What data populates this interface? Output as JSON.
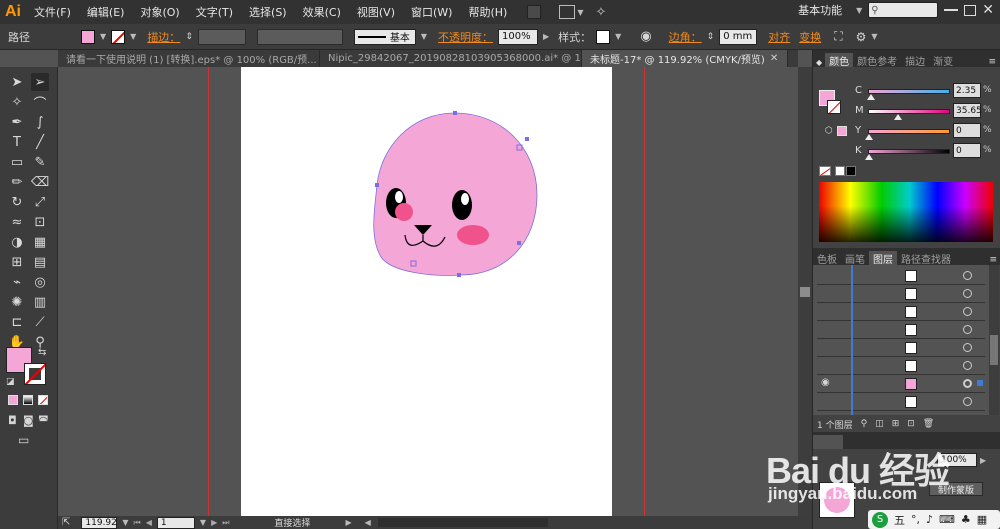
{
  "app": {
    "logo": "Ai",
    "workspace": "基本功能"
  },
  "menu": [
    "文件(F)",
    "编辑(E)",
    "对象(O)",
    "文字(T)",
    "选择(S)",
    "效果(C)",
    "视图(V)",
    "窗口(W)",
    "帮助(H)"
  ],
  "control": {
    "mode_label": "路径",
    "stroke_label": "描边：",
    "stroke_style": "基本",
    "opacity_label": "不透明度：",
    "opacity_value": "100%",
    "style_label": "样式：",
    "corner_label": "边角：",
    "corner_value": "0 mm",
    "align_label": "对齐",
    "transform_label": "变换"
  },
  "tabs": [
    {
      "label": "请看一下使用说明 (1) [转换].eps* @ 100% (RGB/预..."
    },
    {
      "label": "Nipic_29842067_20190828103905368000.ai* @ 11..."
    },
    {
      "label": "未标题-17* @ 119.92% (CMYK/预览)"
    }
  ],
  "color_panel": {
    "tabs": [
      "颜色",
      "颜色参考",
      "描边",
      "渐变"
    ],
    "channels": [
      {
        "name": "C",
        "value": "2.35",
        "level": 0.0235
      },
      {
        "name": "M",
        "value": "35.65",
        "level": 0.3565
      },
      {
        "name": "Y",
        "value": "0",
        "level": 0
      },
      {
        "name": "K",
        "value": "0",
        "level": 0
      }
    ],
    "unit": "%"
  },
  "layers_panel": {
    "tabs": [
      "色板",
      "画笔",
      "图层",
      "路径查找器"
    ],
    "footer_count": "1 个图层"
  },
  "transparency_panel": {
    "opacity_value": "100%",
    "make_mask": "制作蒙版"
  },
  "status": {
    "zoom": "119.92",
    "page": "1",
    "tool": "直接选择"
  },
  "watermark": {
    "brand": "Bai du 经验",
    "url": "jingyan.baidu.com"
  },
  "colors": {
    "fill": "#f4a6d7",
    "cheek": "#f0528c",
    "accent": "#f28a1c"
  },
  "ime": {
    "label": "五"
  }
}
